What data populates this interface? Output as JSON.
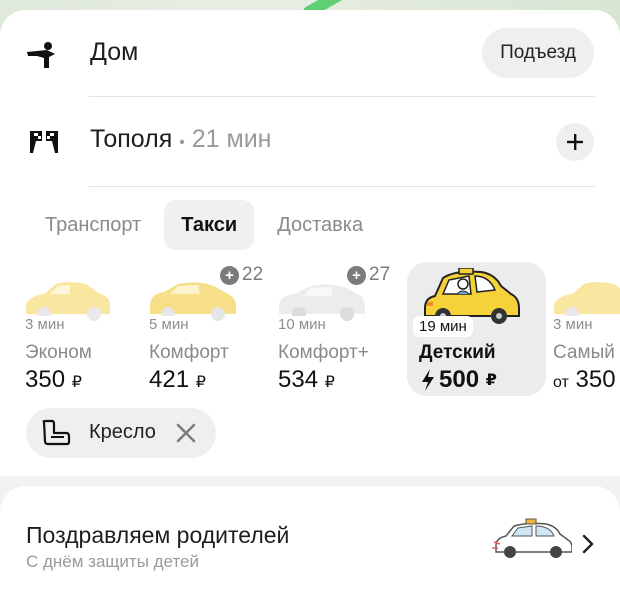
{
  "route": {
    "from": {
      "label": "Дом",
      "action_label": "Подъезд",
      "icon": "pedestrian-icon"
    },
    "to": {
      "label": "Тополя",
      "separator": "•",
      "duration": "21 мин",
      "icon": "finish-flags-icon",
      "action_icon": "plus-icon"
    }
  },
  "tabs": [
    {
      "label": "Транспорт",
      "active": false
    },
    {
      "label": "Такси",
      "active": true
    },
    {
      "label": "Доставка",
      "active": false
    }
  ],
  "tariffs": [
    {
      "eta": "3 мин",
      "name": "Эконом",
      "price": "350",
      "currency": "₽"
    },
    {
      "eta": "5 мин",
      "name": "Комфорт",
      "price": "421",
      "currency": "₽",
      "bonus": "22"
    },
    {
      "eta": "10 мин",
      "name": "Комфорт+",
      "price": "534",
      "currency": "₽",
      "bonus": "27"
    },
    {
      "eta": "19 мин",
      "name": "Детский",
      "price": "500",
      "currency": "₽",
      "selected": true,
      "surge_icon": "lightning-icon"
    },
    {
      "eta": "3 мин",
      "name": "Самый",
      "price_prefix": "от",
      "price": "350"
    }
  ],
  "option_chip": {
    "label": "Кресло",
    "icon": "child-seat-icon",
    "remove_icon": "close-icon"
  },
  "promo": {
    "title": "Поздравляем родителей",
    "subtitle": "С днём защиты детей",
    "icon": "chevron-right-icon"
  },
  "colors": {
    "taxi_yellow": "#f6d23a",
    "selected_card": "#ececec",
    "chip_bg": "#efefef",
    "muted_text": "#8a8a8a"
  }
}
